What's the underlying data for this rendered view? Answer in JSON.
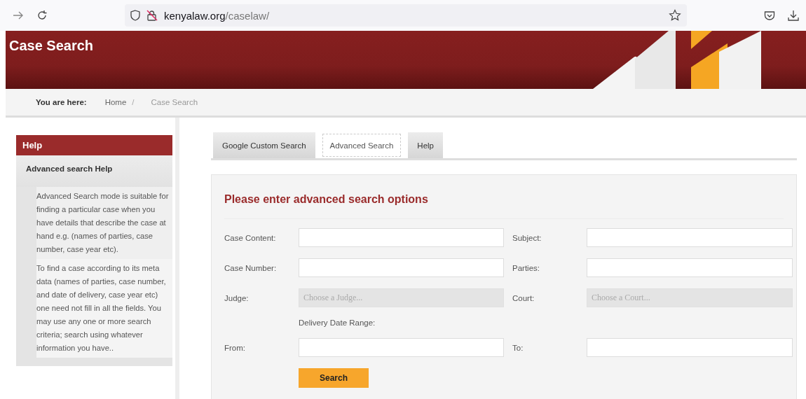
{
  "browser": {
    "url_host": "kenyalaw.org",
    "url_path": "/caselaw/"
  },
  "page_title": "Case Search",
  "breadcrumb": {
    "label": "You are here:",
    "separator": "/",
    "items": [
      {
        "text": "Home",
        "current": false
      },
      {
        "text": "Case Search",
        "current": true
      }
    ]
  },
  "sidebar": {
    "title": "Help",
    "subtitle": "Advanced search Help",
    "paragraphs": [
      "Advanced Search mode is suitable for finding a particular case when you have details that describe the case at hand e.g. (names of parties, case number, case year etc).",
      "To find a case according to its meta data (names of parties, case number, and date of delivery, case year etc) one need not fill in all the fields. You may use any one or more search criteria; search using whatever information you have.."
    ]
  },
  "tabs": [
    {
      "label": "Google Custom Search",
      "selected": false
    },
    {
      "label": "Advanced Search",
      "selected": true
    },
    {
      "label": "Help",
      "selected": false
    }
  ],
  "form": {
    "title": "Please enter advanced search options",
    "fields": [
      {
        "label": "Case Content:",
        "kind": "text"
      },
      {
        "label": "Subject:",
        "kind": "text"
      },
      {
        "label": "Case Number:",
        "kind": "text"
      },
      {
        "label": "Parties:",
        "kind": "text"
      },
      {
        "label": "Judge:",
        "kind": "select",
        "placeholder": "Choose a Judge..."
      },
      {
        "label": "Court:",
        "kind": "select",
        "placeholder": "Choose a Court..."
      }
    ],
    "date_range": {
      "label": "Delivery Date Range:",
      "fields": [
        {
          "label": "From:",
          "kind": "text"
        },
        {
          "label": "To:",
          "kind": "text"
        }
      ]
    },
    "submit": "Search"
  }
}
